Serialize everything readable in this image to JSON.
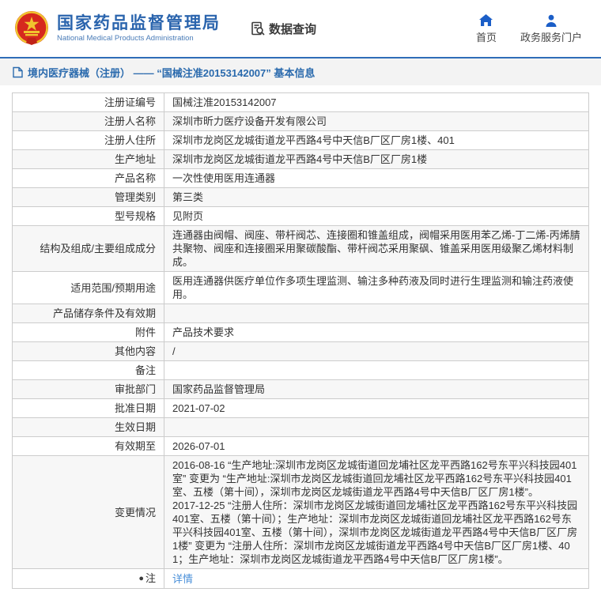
{
  "header": {
    "agency_name_cn": "国家药品监督管理局",
    "agency_name_en": "National Medical Products Administration",
    "data_query_label": "数据查询",
    "nav_home_label": "首页",
    "nav_portal_label": "政务服务门户"
  },
  "title_bar": {
    "text": "境内医疗器械（注册） —— “国械注准20153142007” 基本信息"
  },
  "table": {
    "rows": [
      {
        "label": "注册证编号",
        "value": "国械注准20153142007"
      },
      {
        "label": "注册人名称",
        "value": "深圳市昕力医疗设备开发有限公司"
      },
      {
        "label": "注册人住所",
        "value": "深圳市龙岗区龙城街道龙平西路4号中天信B厂区厂房1楼、401"
      },
      {
        "label": "生产地址",
        "value": "深圳市龙岗区龙城街道龙平西路4号中天信B厂区厂房1楼"
      },
      {
        "label": "产品名称",
        "value": "一次性使用医用连通器"
      },
      {
        "label": "管理类别",
        "value": "第三类"
      },
      {
        "label": "型号规格",
        "value": "见附页"
      },
      {
        "label": "结构及组成/主要组成成分",
        "value": "连通器由阀帽、阀座、带杆阀芯、连接圈和锥盖组成，阀帽采用医用苯乙烯-丁二烯-丙烯腈共聚物、阀座和连接圈采用聚碳酸酯、带杆阀芯采用聚砜、锥盖采用医用级聚乙烯材料制成。"
      },
      {
        "label": "适用范围/预期用途",
        "value": "医用连通器供医疗单位作多项生理监测、输注多种药液及同时进行生理监测和输注药液使用。"
      },
      {
        "label": "产品储存条件及有效期",
        "value": ""
      },
      {
        "label": "附件",
        "value": "产品技术要求"
      },
      {
        "label": "其他内容",
        "value": "/"
      },
      {
        "label": "备注",
        "value": ""
      },
      {
        "label": "审批部门",
        "value": "国家药品监督管理局"
      },
      {
        "label": "批准日期",
        "value": "2021-07-02"
      },
      {
        "label": "生效日期",
        "value": ""
      },
      {
        "label": "有效期至",
        "value": "2026-07-01"
      },
      {
        "label": "变更情况",
        "value": "2016-08-16 “生产地址:深圳市龙岗区龙城街道回龙埔社区龙平西路162号东平兴科技园401室” 变更为 “生产地址:深圳市龙岗区龙城街道回龙埔社区龙平西路162号东平兴科技园401室、五楼（第十间），深圳市龙岗区龙城街道龙平西路4号中天信B厂区厂房1楼”。\n2017-12-25 “注册人住所：深圳市龙岗区龙城街道回龙埔社区龙平西路162号东平兴科技园401室、五楼（第十间）；生产地址：深圳市龙岗区龙城街道回龙埔社区龙平西路162号东平兴科技园401室、五楼（第十间），深圳市龙岗区龙城街道龙平西路4号中天信B厂区厂房1楼” 变更为 “注册人住所：深圳市龙岗区龙城街道龙平西路4号中天信B厂区厂房1楼、401；生产地址：深圳市龙岗区龙城街道龙平西路4号中天信B厂区厂房1楼”。"
      },
      {
        "label": "注",
        "value": "详情",
        "link": true,
        "icon": "note-icon"
      }
    ]
  },
  "colors": {
    "brand_blue": "#2a64ad",
    "title_bar_blue": "#2a6aad",
    "title_bar_border": "#2f6db8",
    "link_blue": "#4a90d9",
    "nav_icon_blue": "#1b5ec7",
    "emblem_red": "#d6281e",
    "emblem_gold": "#f0c52e",
    "row_alt_bg": "#f7f7f7",
    "table_border": "#cccccc"
  }
}
